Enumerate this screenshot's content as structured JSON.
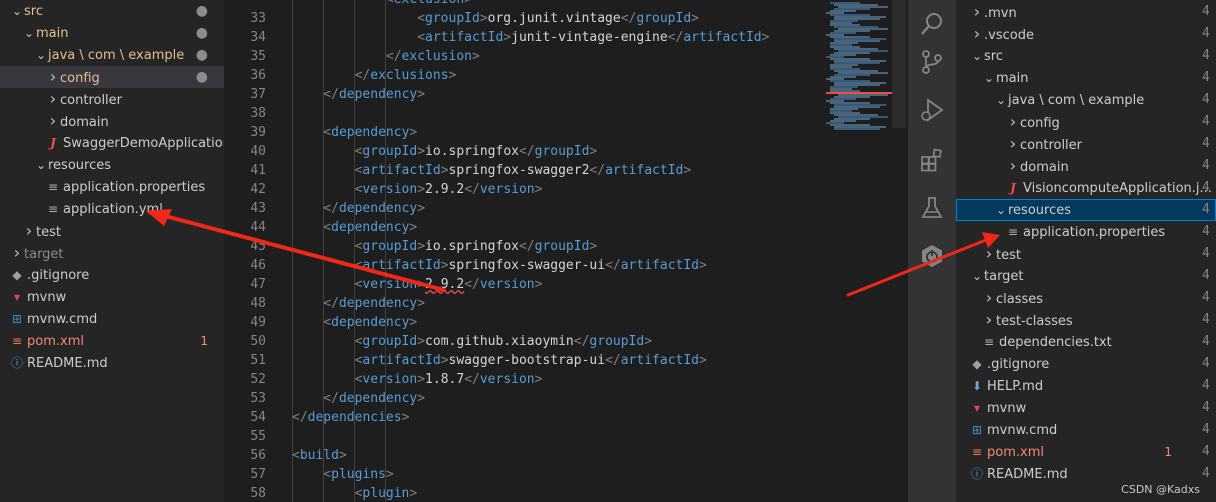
{
  "left_tree": [
    {
      "label": "src",
      "depth": 0,
      "chevron": "open",
      "icon": "",
      "state": "modified",
      "badge": "dot"
    },
    {
      "label": "main",
      "depth": 1,
      "chevron": "open",
      "icon": "",
      "state": "modified",
      "badge": "dot"
    },
    {
      "label": "java \\ com \\ example",
      "depth": 2,
      "chevron": "open",
      "icon": "",
      "state": "modified",
      "badge": "dot"
    },
    {
      "label": "config",
      "depth": 3,
      "chevron": "closed",
      "icon": "",
      "state": "modified",
      "badge": "dot",
      "selected": true
    },
    {
      "label": "controller",
      "depth": 3,
      "chevron": "closed",
      "icon": "",
      "state": "normal",
      "badge": ""
    },
    {
      "label": "domain",
      "depth": 3,
      "chevron": "closed",
      "icon": "",
      "state": "normal",
      "badge": ""
    },
    {
      "label": "SwaggerDemoApplication.j...",
      "depth": 3,
      "chevron": "",
      "icon": "java-icon",
      "state": "normal",
      "badge": ""
    },
    {
      "label": "resources",
      "depth": 2,
      "chevron": "open",
      "icon": "",
      "state": "normal",
      "badge": ""
    },
    {
      "label": "application.properties",
      "depth": 3,
      "chevron": "",
      "icon": "lines-icon",
      "state": "normal",
      "badge": ""
    },
    {
      "label": "application.yml",
      "depth": 3,
      "chevron": "",
      "icon": "lines-icon",
      "state": "normal",
      "badge": ""
    },
    {
      "label": "test",
      "depth": 1,
      "chevron": "closed",
      "icon": "",
      "state": "normal",
      "badge": ""
    },
    {
      "label": "target",
      "depth": 0,
      "chevron": "closed",
      "icon": "",
      "state": "dim",
      "badge": ""
    },
    {
      "label": ".gitignore",
      "depth": 0,
      "chevron": "",
      "icon": "git-icon",
      "state": "normal",
      "badge": ""
    },
    {
      "label": "mvnw",
      "depth": 0,
      "chevron": "",
      "icon": "mvn-icon",
      "state": "normal",
      "badge": ""
    },
    {
      "label": "mvnw.cmd",
      "depth": 0,
      "chevron": "",
      "icon": "windows-icon",
      "state": "normal",
      "badge": ""
    },
    {
      "label": "pom.xml",
      "depth": 0,
      "chevron": "",
      "icon": "rss-icon",
      "state": "error",
      "badge": "1"
    },
    {
      "label": "README.md",
      "depth": 0,
      "chevron": "",
      "icon": "info-icon",
      "state": "normal",
      "badge": ""
    }
  ],
  "right_tree": [
    {
      "label": ".mvn",
      "depth": 0,
      "chevron": "closed",
      "icon": "",
      "state": "normal",
      "badge": ""
    },
    {
      "label": ".vscode",
      "depth": 0,
      "chevron": "closed",
      "icon": "",
      "state": "normal",
      "badge": ""
    },
    {
      "label": "src",
      "depth": 0,
      "chevron": "open",
      "icon": "",
      "state": "normal",
      "badge": ""
    },
    {
      "label": "main",
      "depth": 1,
      "chevron": "open",
      "icon": "",
      "state": "normal",
      "badge": ""
    },
    {
      "label": "java \\ com \\ example",
      "depth": 2,
      "chevron": "open",
      "icon": "",
      "state": "normal",
      "badge": ""
    },
    {
      "label": "config",
      "depth": 3,
      "chevron": "closed",
      "icon": "",
      "state": "normal",
      "badge": ""
    },
    {
      "label": "controller",
      "depth": 3,
      "chevron": "closed",
      "icon": "",
      "state": "normal",
      "badge": ""
    },
    {
      "label": "domain",
      "depth": 3,
      "chevron": "closed",
      "icon": "",
      "state": "normal",
      "badge": ""
    },
    {
      "label": "VisioncomputeApplication.j...",
      "depth": 3,
      "chevron": "",
      "icon": "java-icon",
      "state": "normal",
      "badge": ""
    },
    {
      "label": "resources",
      "depth": 2,
      "chevron": "open",
      "icon": "",
      "state": "normal",
      "badge": "",
      "focused": true
    },
    {
      "label": "application.properties",
      "depth": 3,
      "chevron": "",
      "icon": "lines-icon",
      "state": "normal",
      "badge": ""
    },
    {
      "label": "test",
      "depth": 1,
      "chevron": "closed",
      "icon": "",
      "state": "normal",
      "badge": ""
    },
    {
      "label": "target",
      "depth": 0,
      "chevron": "open",
      "icon": "",
      "state": "normal",
      "badge": ""
    },
    {
      "label": "classes",
      "depth": 1,
      "chevron": "closed",
      "icon": "",
      "state": "normal",
      "badge": ""
    },
    {
      "label": "test-classes",
      "depth": 1,
      "chevron": "closed",
      "icon": "",
      "state": "normal",
      "badge": ""
    },
    {
      "label": "dependencies.txt",
      "depth": 1,
      "chevron": "",
      "icon": "lines-icon",
      "state": "normal",
      "badge": ""
    },
    {
      "label": ".gitignore",
      "depth": 0,
      "chevron": "",
      "icon": "git-icon",
      "state": "normal",
      "badge": ""
    },
    {
      "label": "HELP.md",
      "depth": 0,
      "chevron": "",
      "icon": "download-icon",
      "state": "normal",
      "badge": ""
    },
    {
      "label": "mvnw",
      "depth": 0,
      "chevron": "",
      "icon": "mvn-icon",
      "state": "normal",
      "badge": ""
    },
    {
      "label": "mvnw.cmd",
      "depth": 0,
      "chevron": "",
      "icon": "windows-icon",
      "state": "normal",
      "badge": ""
    },
    {
      "label": "pom.xml",
      "depth": 0,
      "chevron": "",
      "icon": "rss-icon",
      "state": "error",
      "badge": "1"
    },
    {
      "label": "README.md",
      "depth": 0,
      "chevron": "",
      "icon": "info-icon",
      "state": "normal",
      "badge": ""
    }
  ],
  "code_lines": [
    {
      "n": "",
      "indent": 3,
      "tokens": [
        [
          "brk",
          "<"
        ],
        [
          "tag",
          "exclusion"
        ],
        [
          "brk",
          ">"
        ]
      ]
    },
    {
      "n": "33",
      "indent": 4,
      "tokens": [
        [
          "brk",
          "<"
        ],
        [
          "tag",
          "groupId"
        ],
        [
          "brk",
          ">"
        ],
        [
          "txt",
          "org.junit.vintage"
        ],
        [
          "brk",
          "</"
        ],
        [
          "tag",
          "groupId"
        ],
        [
          "brk",
          ">"
        ]
      ]
    },
    {
      "n": "34",
      "indent": 4,
      "tokens": [
        [
          "brk",
          "<"
        ],
        [
          "tag",
          "artifactId"
        ],
        [
          "brk",
          ">"
        ],
        [
          "txt",
          "junit-vintage-engine"
        ],
        [
          "brk",
          "</"
        ],
        [
          "tag",
          "artifactId"
        ],
        [
          "brk",
          ">"
        ]
      ]
    },
    {
      "n": "35",
      "indent": 3,
      "tokens": [
        [
          "brk",
          "</"
        ],
        [
          "tag",
          "exclusion"
        ],
        [
          "brk",
          ">"
        ]
      ]
    },
    {
      "n": "36",
      "indent": 2,
      "tokens": [
        [
          "brk",
          "</"
        ],
        [
          "tag",
          "exclusions"
        ],
        [
          "brk",
          ">"
        ]
      ]
    },
    {
      "n": "37",
      "indent": 1,
      "tokens": [
        [
          "brk",
          "</"
        ],
        [
          "tag",
          "dependency"
        ],
        [
          "brk",
          ">"
        ]
      ]
    },
    {
      "n": "38",
      "indent": 0,
      "tokens": []
    },
    {
      "n": "39",
      "indent": 1,
      "tokens": [
        [
          "brk",
          "<"
        ],
        [
          "tag",
          "dependency"
        ],
        [
          "brk",
          ">"
        ]
      ]
    },
    {
      "n": "40",
      "indent": 2,
      "tokens": [
        [
          "brk",
          "<"
        ],
        [
          "tag",
          "groupId"
        ],
        [
          "brk",
          ">"
        ],
        [
          "txt",
          "io.springfox"
        ],
        [
          "brk",
          "</"
        ],
        [
          "tag",
          "groupId"
        ],
        [
          "brk",
          ">"
        ]
      ]
    },
    {
      "n": "41",
      "indent": 2,
      "tokens": [
        [
          "brk",
          "<"
        ],
        [
          "tag",
          "artifactId"
        ],
        [
          "brk",
          ">"
        ],
        [
          "txt",
          "springfox-swagger2"
        ],
        [
          "brk",
          "</"
        ],
        [
          "tag",
          "artifactId"
        ],
        [
          "brk",
          ">"
        ]
      ]
    },
    {
      "n": "42",
      "indent": 2,
      "tokens": [
        [
          "brk",
          "<"
        ],
        [
          "tag",
          "version"
        ],
        [
          "brk",
          ">"
        ],
        [
          "txt",
          "2.9.2"
        ],
        [
          "brk",
          "</"
        ],
        [
          "tag",
          "version"
        ],
        [
          "brk",
          ">"
        ]
      ]
    },
    {
      "n": "43",
      "indent": 1,
      "tokens": [
        [
          "brk",
          "</"
        ],
        [
          "tag",
          "dependency"
        ],
        [
          "brk",
          ">"
        ]
      ]
    },
    {
      "n": "44",
      "indent": 1,
      "tokens": [
        [
          "brk",
          "<"
        ],
        [
          "tag",
          "dependency"
        ],
        [
          "brk",
          ">"
        ]
      ]
    },
    {
      "n": "45",
      "indent": 2,
      "tokens": [
        [
          "brk",
          "<"
        ],
        [
          "tag",
          "groupId"
        ],
        [
          "brk",
          ">"
        ],
        [
          "txt",
          "io.springfox"
        ],
        [
          "brk",
          "</"
        ],
        [
          "tag",
          "groupId"
        ],
        [
          "brk",
          ">"
        ]
      ]
    },
    {
      "n": "46",
      "indent": 2,
      "tokens": [
        [
          "brk",
          "<"
        ],
        [
          "tag",
          "artifactId"
        ],
        [
          "brk",
          ">"
        ],
        [
          "txt",
          "springfox-swagger-ui"
        ],
        [
          "brk",
          "</"
        ],
        [
          "tag",
          "artifactId"
        ],
        [
          "brk",
          ">"
        ]
      ]
    },
    {
      "n": "47",
      "indent": 2,
      "tokens": [
        [
          "brk",
          "<"
        ],
        [
          "tag",
          "version"
        ],
        [
          "brk",
          ">"
        ],
        [
          "sq",
          "2.9.2"
        ],
        [
          "brk",
          "</"
        ],
        [
          "tag",
          "version"
        ],
        [
          "brk",
          ">"
        ]
      ]
    },
    {
      "n": "48",
      "indent": 1,
      "tokens": [
        [
          "brk",
          "</"
        ],
        [
          "tag",
          "dependency"
        ],
        [
          "brk",
          ">"
        ]
      ]
    },
    {
      "n": "49",
      "indent": 1,
      "tokens": [
        [
          "brk",
          "<"
        ],
        [
          "tag",
          "dependency"
        ],
        [
          "brk",
          ">"
        ]
      ]
    },
    {
      "n": "50",
      "indent": 2,
      "tokens": [
        [
          "brk",
          "<"
        ],
        [
          "tag",
          "groupId"
        ],
        [
          "brk",
          ">"
        ],
        [
          "txt",
          "com.github.xiaoymin"
        ],
        [
          "brk",
          "</"
        ],
        [
          "tag",
          "groupId"
        ],
        [
          "brk",
          ">"
        ]
      ]
    },
    {
      "n": "51",
      "indent": 2,
      "tokens": [
        [
          "brk",
          "<"
        ],
        [
          "tag",
          "artifactId"
        ],
        [
          "brk",
          ">"
        ],
        [
          "txt",
          "swagger-bootstrap-ui"
        ],
        [
          "brk",
          "</"
        ],
        [
          "tag",
          "artifactId"
        ],
        [
          "brk",
          ">"
        ]
      ]
    },
    {
      "n": "52",
      "indent": 2,
      "tokens": [
        [
          "brk",
          "<"
        ],
        [
          "tag",
          "version"
        ],
        [
          "brk",
          ">"
        ],
        [
          "txt",
          "1.8.7"
        ],
        [
          "brk",
          "</"
        ],
        [
          "tag",
          "version"
        ],
        [
          "brk",
          ">"
        ]
      ]
    },
    {
      "n": "53",
      "indent": 1,
      "tokens": [
        [
          "brk",
          "</"
        ],
        [
          "tag",
          "dependency"
        ],
        [
          "brk",
          ">"
        ]
      ]
    },
    {
      "n": "54",
      "indent": 0,
      "tokens": [
        [
          "brk",
          "</"
        ],
        [
          "tag",
          "dependencies"
        ],
        [
          "brk",
          ">"
        ]
      ]
    },
    {
      "n": "55",
      "indent": 0,
      "tokens": []
    },
    {
      "n": "56",
      "indent": 0,
      "tokens": [
        [
          "brk",
          "<"
        ],
        [
          "tag",
          "build"
        ],
        [
          "brk",
          ">"
        ]
      ]
    },
    {
      "n": "57",
      "indent": 1,
      "tokens": [
        [
          "brk",
          "<"
        ],
        [
          "tag",
          "plugins"
        ],
        [
          "brk",
          ">"
        ]
      ]
    },
    {
      "n": "58",
      "indent": 2,
      "tokens": [
        [
          "brk",
          "<"
        ],
        [
          "tag",
          "plugin"
        ],
        [
          "brk",
          ">"
        ]
      ]
    }
  ],
  "overflow_chars": [
    "4",
    "4",
    "4",
    "4",
    "4",
    "4",
    "4",
    "4",
    "4",
    "4",
    "4",
    "4",
    "4",
    "4",
    "4",
    "4",
    "4",
    "4",
    "4",
    "4",
    "4",
    "4"
  ],
  "activity_icons": [
    "search-icon",
    "source-control-icon",
    "run-debug-icon",
    "extensions-icon",
    "testing-icon",
    "spring-boot-icon"
  ],
  "watermark": "CSDN @Kadxs",
  "colors": {
    "tag": "#569cd6",
    "bracket": "#808080",
    "text": "#d4d4d4",
    "modified": "#e2c08d",
    "error": "#f48771",
    "arrow": "#f02818",
    "focus": "#007fd4"
  }
}
